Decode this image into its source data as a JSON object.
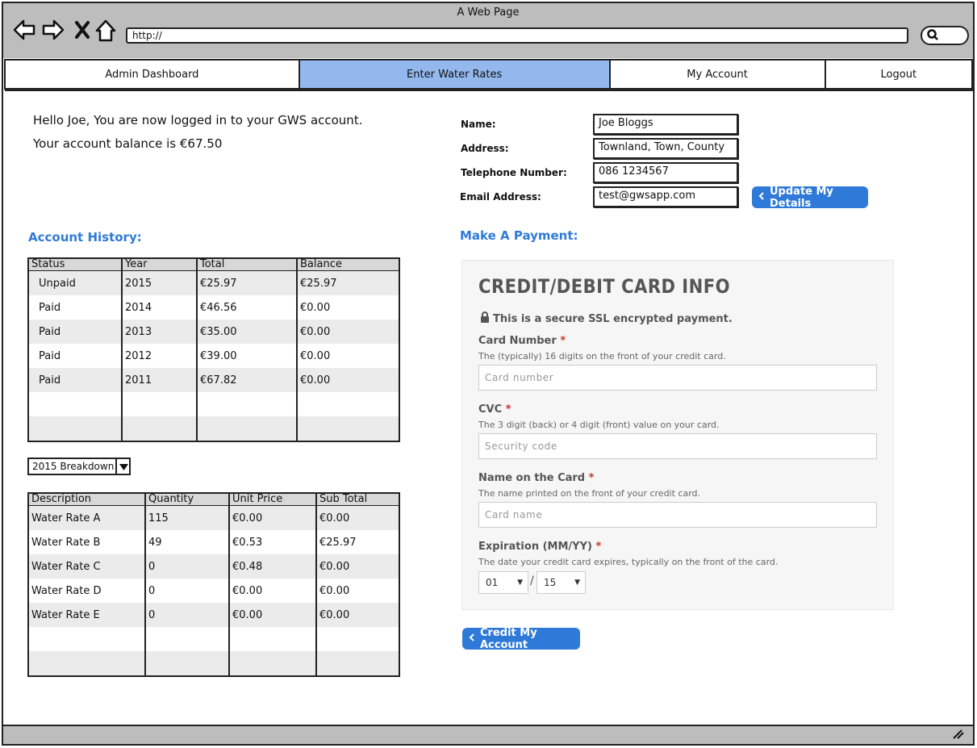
{
  "browser": {
    "title": "A Web Page",
    "url": "http://",
    "icons": [
      "back-icon",
      "forward-icon",
      "close-icon",
      "home-icon",
      "search-icon"
    ]
  },
  "tabs": [
    {
      "label": "Admin Dashboard",
      "active": false
    },
    {
      "label": "Enter Water Rates",
      "active": true
    },
    {
      "label": "My Account",
      "active": false
    },
    {
      "label": "Logout",
      "active": false
    }
  ],
  "greeting": {
    "line1": "Hello Joe, You are now logged in to your GWS account.",
    "line2": "Your account balance is €67.50"
  },
  "details": {
    "name_label": "Name:",
    "name_value": "Joe Bloggs",
    "address_label": "Address:",
    "address_value": "Townland, Town, County",
    "phone_label": "Telephone Number:",
    "phone_value": "086 1234567",
    "email_label": "Email Address:",
    "email_value": "test@gwsapp.com",
    "update_button": "Update My Details"
  },
  "account_history": {
    "title": "Account History:",
    "columns": [
      "Status",
      "Year",
      "Total",
      "Balance"
    ],
    "rows": [
      [
        "Unpaid",
        "2015",
        "€25.97",
        "€25.97"
      ],
      [
        "Paid",
        "2014",
        "€46.56",
        "€0.00"
      ],
      [
        "Paid",
        "2013",
        "€35.00",
        "€0.00"
      ],
      [
        "Paid",
        "2012",
        "€39.00",
        "€0.00"
      ],
      [
        "Paid",
        "2011",
        "€67.82",
        "€0.00"
      ],
      [
        "",
        "",
        "",
        ""
      ],
      [
        "",
        "",
        "",
        ""
      ]
    ]
  },
  "breakdown": {
    "selected": "2015 Breakdown",
    "columns": [
      "Description",
      "Quantity",
      "Unit Price",
      "Sub Total"
    ],
    "rows": [
      [
        "Water Rate A",
        "115",
        "€0.00",
        "€0.00"
      ],
      [
        "Water Rate B",
        "49",
        "€0.53",
        "€25.97"
      ],
      [
        "Water Rate C",
        "0",
        "€0.48",
        "€0.00"
      ],
      [
        "Water Rate D",
        "0",
        "€0.00",
        "€0.00"
      ],
      [
        "Water Rate E",
        "0",
        "€0.00",
        "€0.00"
      ],
      [
        "",
        "",
        "",
        ""
      ],
      [
        "",
        "",
        "",
        ""
      ]
    ]
  },
  "payment": {
    "title": "Make A Payment:",
    "card_title": "CREDIT/DEBIT CARD INFO",
    "secure_note": "This is a secure SSL encrypted payment.",
    "card_number_label": "Card Number",
    "card_number_hint": "The (typically) 16 digits on the front of your credit card.",
    "card_number_placeholder": "Card number",
    "cvc_label": "CVC",
    "cvc_hint": "The 3 digit (back) or 4 digit (front) value on your card.",
    "cvc_placeholder": "Security code",
    "name_label": "Name on the Card",
    "name_hint": "The name printed on the front of your credit card.",
    "name_placeholder": "Card name",
    "expiry_label": "Expiration (MM/YY)",
    "expiry_hint": "The date your credit card expires, typically on the front of the card.",
    "expiry_month": "01",
    "expiry_year": "15",
    "expiry_sep": "/",
    "required_mark": "*",
    "credit_button": "Credit My Account"
  }
}
